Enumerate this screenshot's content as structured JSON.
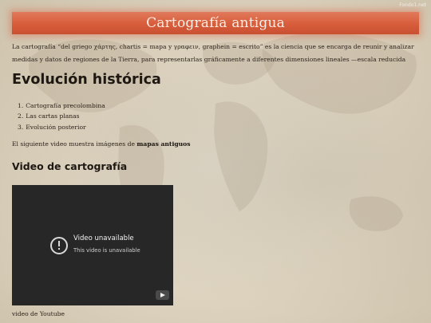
{
  "watermark": "Fondo1.net",
  "header": {
    "title": "Cartografía antigua"
  },
  "intro": "La cartografía “del griego χάρτης, chartis = mapa y γραφειν, graphein = escrito” es la ciencia que se encarga de reunir y analizar medidas y datos de regiones de la Tierra, para representarlas gráficamente a diferentes dimensiones lineales —escala reducida",
  "section1": {
    "heading": "Evolución histórica",
    "items": [
      {
        "num": "1.",
        "label": "Cartografía precolombina"
      },
      {
        "num": "2.",
        "label": "Las cartas planas"
      },
      {
        "num": "3.",
        "label": "Evolución posterior"
      }
    ]
  },
  "note": {
    "prefix": "El siguiente video muestra imágenes de ",
    "link": "mapas antiguos"
  },
  "section2": {
    "heading": "Video de cartografía"
  },
  "video": {
    "title": "Video unavailable",
    "subtitle": "This video is unavailable"
  },
  "caption": "video de Youtube"
}
